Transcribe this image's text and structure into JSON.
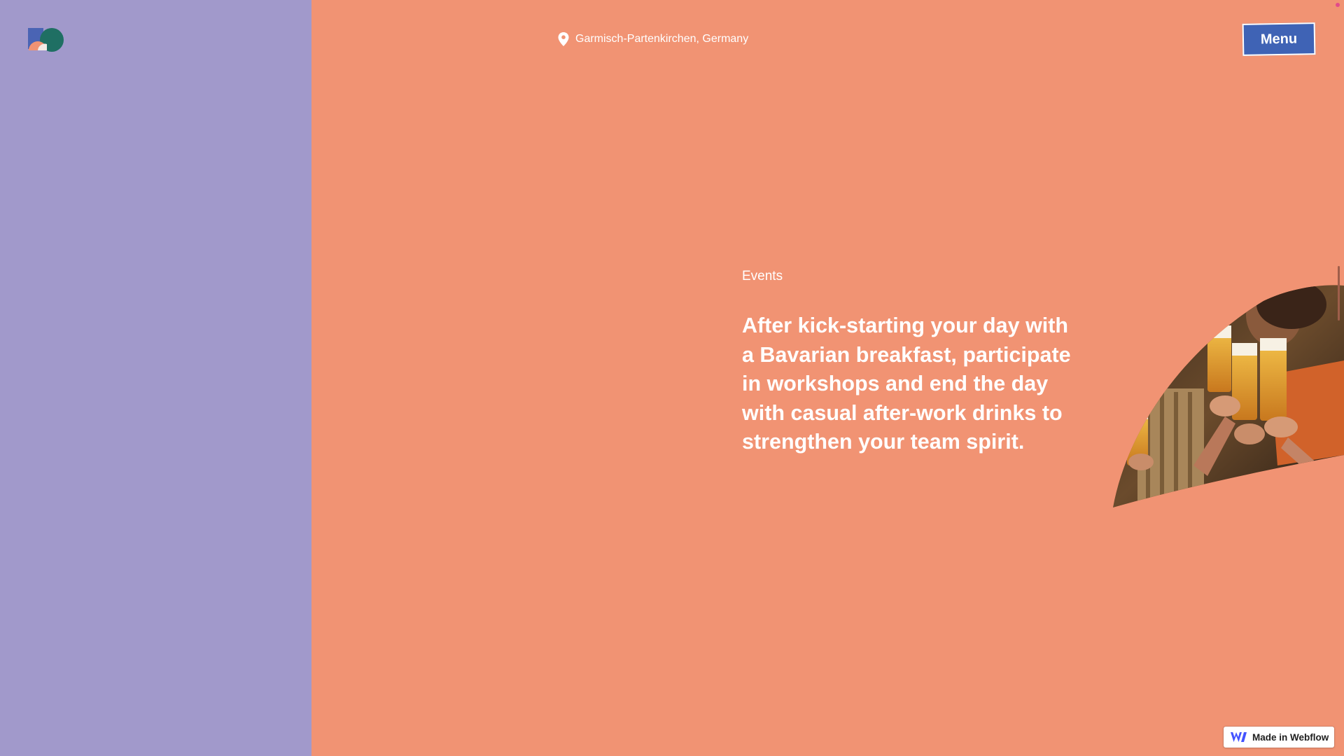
{
  "header": {
    "location": "Garmisch-Partenkirchen, Germany",
    "menu_label": "Menu"
  },
  "content": {
    "section_label": "Events",
    "headline": "After kick-starting your day with a Bavarian breakfast, participate in workshops and end the day with casual after-work drinks to strengthen your team spirit."
  },
  "footer": {
    "badge_label": "Made in Webflow"
  },
  "icons": {
    "logo": "logo-icon",
    "location": "map-pin-icon",
    "webflow": "webflow-icon"
  },
  "colors": {
    "left_panel": "#a199cb",
    "main_background": "#f19373",
    "menu_button": "#3f63b5",
    "text": "#ffffff"
  }
}
